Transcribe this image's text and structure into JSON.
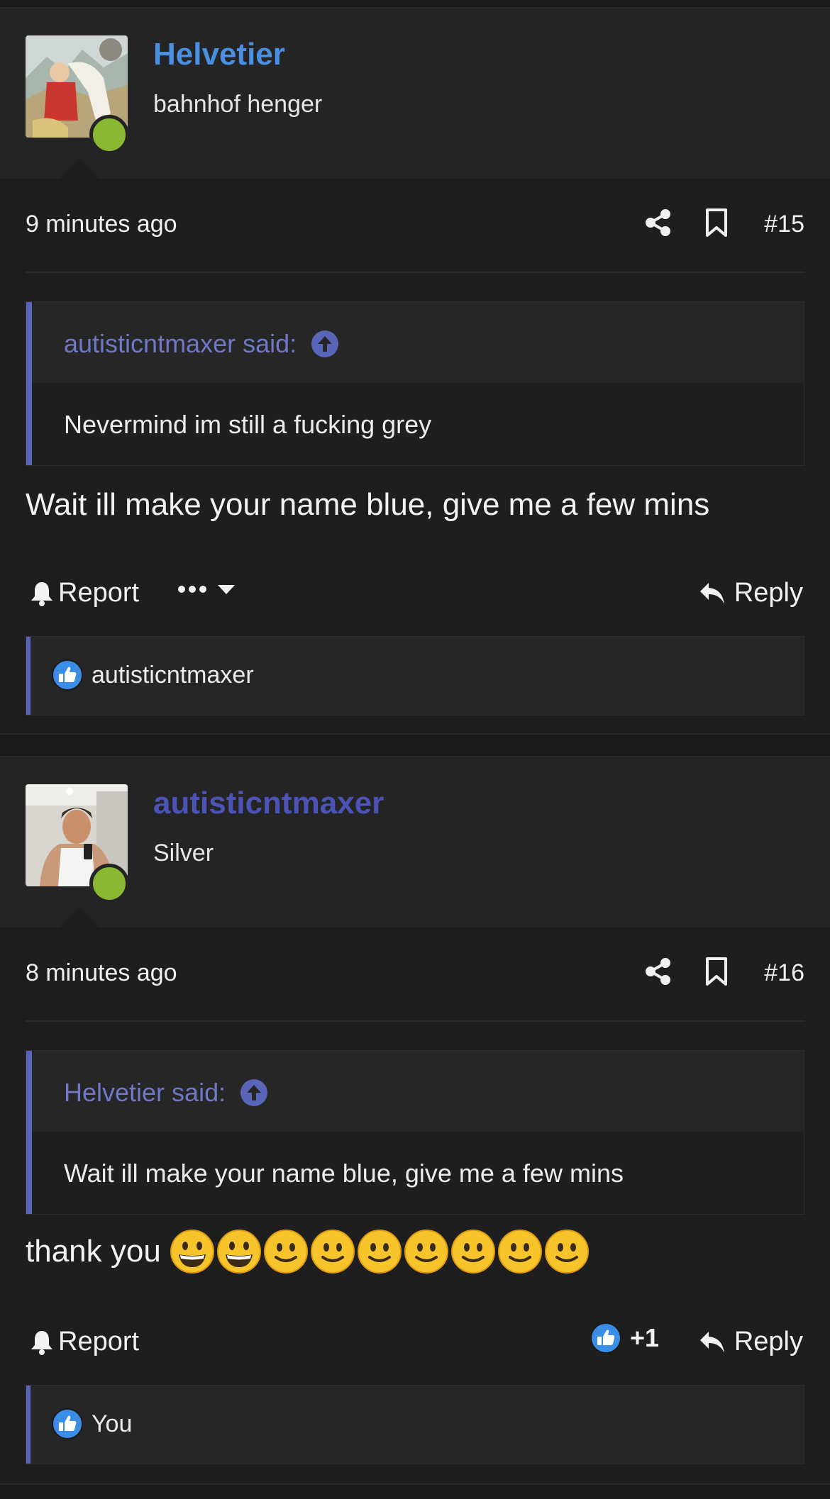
{
  "colors": {
    "helvetier_name": "#4a90e2",
    "autistic_name": "#4b54b6",
    "quote_accent": "#5865b8",
    "online": "#8ab833",
    "like_blue": "#3a8ee6"
  },
  "posts": [
    {
      "username": "Helvetier",
      "user_title": "bahnhof henger",
      "time": "9 minutes ago",
      "number": "#15",
      "quote_author": "autisticntmaxer said:",
      "quote_text": "Nevermind im still a fucking grey",
      "message": "Wait ill make your name blue, give me a few mins",
      "report_label": "Report",
      "reply_label": "Reply",
      "reactions_text": "autisticntmaxer"
    },
    {
      "username": "autisticntmaxer",
      "user_title": "Silver",
      "time": "8 minutes ago",
      "number": "#16",
      "quote_author": "Helvetier said:",
      "quote_text": "Wait ill make your name blue, give me a few mins",
      "message": "thank you",
      "emojis": [
        "grinning-emoji",
        "grinning-emoji",
        "smiling-emoji",
        "smiling-emoji",
        "smiling-emoji",
        "smiling-emoji",
        "smiling-emoji",
        "smiling-emoji",
        "smiling-emoji"
      ],
      "report_label": "Report",
      "like_count": "+1",
      "reply_label": "Reply",
      "reactions_text": "You"
    }
  ]
}
